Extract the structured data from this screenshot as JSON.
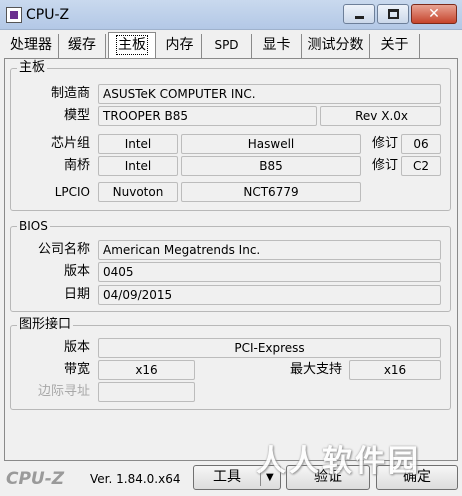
{
  "window": {
    "title": "CPU-Z",
    "close_glyph": "✕"
  },
  "tabs": [
    {
      "label": "处理器"
    },
    {
      "label": "缓存"
    },
    {
      "label": "主板"
    },
    {
      "label": "内存"
    },
    {
      "label": "SPD"
    },
    {
      "label": "显卡"
    },
    {
      "label": "测试分数"
    },
    {
      "label": "关于"
    }
  ],
  "active_tab": "主板",
  "motherboard": {
    "group_title": "主板",
    "manufacturer_label": "制造商",
    "manufacturer": "ASUSTeK COMPUTER INC.",
    "model_label": "模型",
    "model": "TROOPER B85",
    "model_rev": "Rev X.0x",
    "chipset_label": "芯片组",
    "chipset_vendor": "Intel",
    "chipset_name": "Haswell",
    "revision_label": "修订",
    "chipset_rev": "06",
    "southbridge_label": "南桥",
    "sb_vendor": "Intel",
    "sb_name": "B85",
    "sb_rev": "C2",
    "lpcio_label": "LPCIO",
    "lpcio_vendor": "Nuvoton",
    "lpcio_name": "NCT6779"
  },
  "bios": {
    "group_title": "BIOS",
    "brand_label": "公司名称",
    "brand": "American Megatrends Inc.",
    "version_label": "版本",
    "version": "0405",
    "date_label": "日期",
    "date": "04/09/2015"
  },
  "graphic_interface": {
    "group_title": "图形接口",
    "version_label": "版本",
    "version": "PCI-Express",
    "link_width_label": "带宽",
    "link_width": "x16",
    "max_supported_label": "最大支持",
    "max_supported": "x16",
    "side_band_label": "边际寻址",
    "side_band": ""
  },
  "footer": {
    "logo": "CPU-Z",
    "version": "Ver. 1.84.0.x64",
    "tools_label": "工具",
    "tools_arrow": "▼",
    "validate_label": "验证",
    "ok_label": "确定"
  },
  "watermark": "人人软件园",
  "icons": {
    "app": "cpu-z-app-icon",
    "minimize": "minimize-icon",
    "maximize": "maximize-icon",
    "close": "close-icon",
    "dropdown": "chevron-down-icon"
  },
  "colors": {
    "titlebar": "#b3c8e6",
    "close_button": "#c6442c",
    "panel": "#f0f0f0",
    "field_border": "#bcbcbc"
  }
}
